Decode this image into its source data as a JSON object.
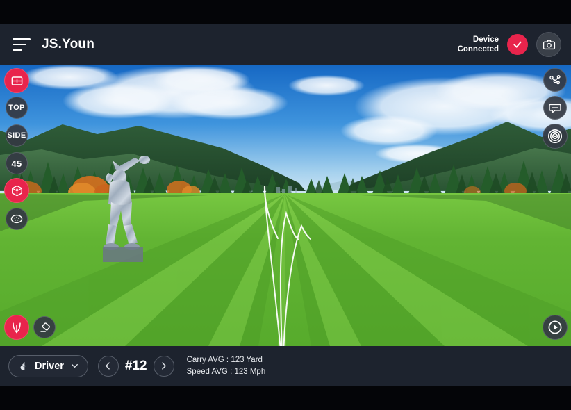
{
  "header": {
    "menu_icon": "hamburger-icon",
    "user_name": "JS.Youn",
    "device_status_line1": "Device",
    "device_status_line2": "Connected",
    "status_icon": "check-icon",
    "camera_icon": "camera-icon"
  },
  "left_toolbar": [
    {
      "name": "layout-view",
      "icon": "layout-icon",
      "label": "",
      "active": true
    },
    {
      "name": "top-view",
      "icon": "",
      "label": "TOP",
      "active": false
    },
    {
      "name": "side-view",
      "icon": "",
      "label": "SIDE",
      "active": false
    },
    {
      "name": "angle-45-view",
      "icon": "",
      "label": "45",
      "active": false
    },
    {
      "name": "three-d-view",
      "icon": "cube-icon",
      "label": "",
      "active": true
    },
    {
      "name": "ball-view",
      "icon": "golf-ball-icon",
      "label": "",
      "active": false
    }
  ],
  "left_bottom_toolbar": [
    {
      "name": "trajectory-toggle",
      "icon": "trajectory-icon",
      "active": true
    },
    {
      "name": "erase-trajectory",
      "icon": "eraser-icon",
      "active": false
    }
  ],
  "right_toolbar": [
    {
      "name": "shot-graph",
      "icon": "node-graph-icon"
    },
    {
      "name": "chat-panel",
      "icon": "chat-bubble-icon"
    },
    {
      "name": "target-view",
      "icon": "target-icon"
    }
  ],
  "right_bottom_toolbar": [
    {
      "name": "play-replay",
      "icon": "play-icon"
    }
  ],
  "bottom_bar": {
    "club_icon": "golf-club-icon",
    "club_name": "Driver",
    "club_chevron": "chevron-down-icon",
    "prev_icon": "chevron-left-icon",
    "next_icon": "chevron-right-icon",
    "shot_number": "#12",
    "carry_avg": "Carry AVG : 123 Yard",
    "speed_avg": "Speed AVG : 123 Mph"
  },
  "colors": {
    "accent_red": "#e8244c",
    "panel_dark": "#1d232e",
    "letterbox": "#040508",
    "sky_top": "#1f7fd8",
    "sky_bottom": "#bcdcf4",
    "fairway_light": "#6fc03a",
    "fairway_dark": "#4c9a24",
    "trajectory_line": "#ffffff"
  },
  "scene": {
    "name": "golf-driving-range",
    "statue": "golfer-statue",
    "trajectories": 3
  }
}
